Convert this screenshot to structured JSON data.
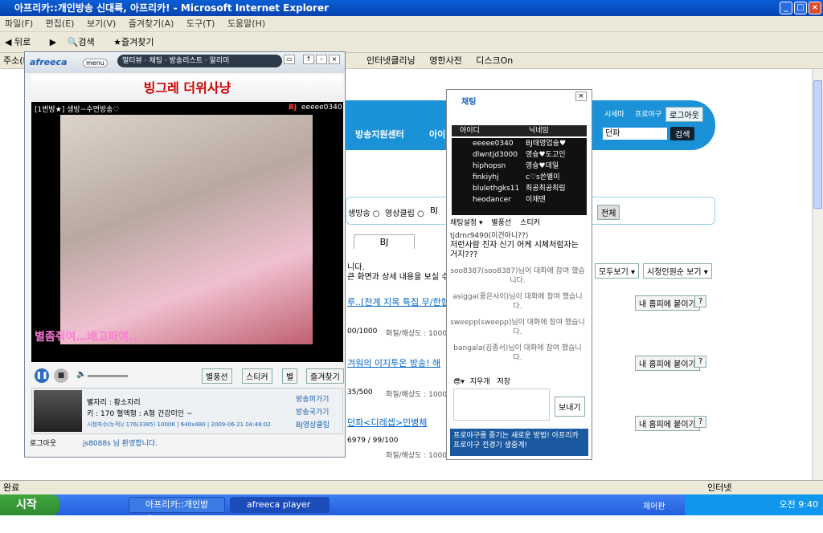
{
  "ie": {
    "title": "아프리카::개인방송 신대륙, 아프리카! - Microsoft Internet Explorer",
    "menu": [
      "파일(F)",
      "편집(E)",
      "보기(V)",
      "즐겨찾기(A)",
      "도구(T)",
      "도움말(H)"
    ],
    "toolbar": [
      "뒤로",
      "검색",
      "즐겨찾기"
    ],
    "address_label": "주소(D)",
    "links": [
      "인터넷클리닝",
      "영한사전",
      "디스크On"
    ],
    "status": "완료",
    "zone": "인터넷"
  },
  "site": {
    "nav": [
      "방송지원센터",
      "아이"
    ],
    "top_links": [
      "시세마",
      "프로야구",
      "로그아웃"
    ],
    "search_value": "던파",
    "search_button": "검색",
    "radio": [
      "생방송",
      "영상클립",
      "BJ"
    ],
    "all": "전체",
    "tab": "BJ",
    "view_select": "모두보기",
    "sort_select": "시청인원순 보기",
    "rows": [
      {
        "title": "루..[천계 지옥 특집 무/한협",
        "meta": "00/1000",
        "res": "화질/해상도 : 1000"
      },
      {
        "title": "겨워의 이지투온 방송! 해",
        "meta": "35/500",
        "res": "화질/해상도 : 1000K/"
      },
      {
        "title": "던파<디레셉>민병체",
        "meta": "6979 / 99/100",
        "res": "화질/해상도 : 1000K/"
      }
    ],
    "homepage_button": "내 홈피에 붙이기",
    "help": "?",
    "notice": "니다.",
    "notice2": "큰 화면과 상세 내용을 보실 수"
  },
  "player": {
    "brand": "afreeca",
    "menu": "menu",
    "nav": [
      "멀티뷰",
      "채팅",
      "방송리스트",
      "알리미"
    ],
    "banner": "빙그레 더위사냥",
    "room": "[1번방★] 생방~수면방송♡",
    "bj_label": "BJ",
    "bj_id": "eeeee0340",
    "subtitle": "별좀줘여…배고파여..",
    "buttons": [
      "별풍선",
      "스티커",
      "별",
      "즐겨찾기"
    ],
    "info": {
      "star": "별자리 : 황소자리",
      "height": "키 : 170 혈액형 : A형 건강미인 ~",
      "viewers": "시청자수(누적)/ 176(3385) 1000K | 640x480 | 2009-06-21 04:48:02"
    },
    "side_buttons": [
      "방송퍼가기",
      "방송국가기",
      "BJ영상클립"
    ],
    "footer_logout": "로그아웃",
    "footer_welcome": "js8088s 님 환영합니다."
  },
  "chat": {
    "title": "채팅",
    "headers": [
      "아이디",
      "닉네임"
    ],
    "users": [
      {
        "id": "eeeee0340",
        "nick": "BJ태영업슝♥"
      },
      {
        "id": "dlwntjd3000",
        "nick": "영슝♥도고인"
      },
      {
        "id": "hiphopsn",
        "nick": "영슝♥데일"
      },
      {
        "id": "finkiyhj",
        "nick": "c♡s쓴별이"
      },
      {
        "id": "blulethgks11",
        "nick": "최공최공최링"
      },
      {
        "id": "heodancer",
        "nick": "이채덴"
      }
    ],
    "tabs": [
      "채팅설정",
      "별풍선",
      "스티커"
    ],
    "messages": [
      "tjdrnr9490(이건아니??)",
      "저런사람 진자 신기 어케 시체처럼자는거지???",
      "soo8387(soo8387)님이 대화에 참여 했습니다.",
      "asigga(풍은사이)님이 대화에 참여 했습니다.",
      "sweepp(sweepp)님이 대화에 참여 했습니다.",
      "bangala(김종서)님이 대화에 참여 했습니다."
    ],
    "tools": [
      "지우개",
      "저장"
    ],
    "send": "보내기",
    "ad": "프로야구를 즐기는 새로운 방법! 아프리카 프로야구 전경기 생중계!"
  },
  "taskbar": {
    "start": "시작",
    "tasks": [
      "아프리카::개인방송...",
      "afreeca player"
    ],
    "clock": "오전 9:40",
    "tray_label": "제어판"
  }
}
